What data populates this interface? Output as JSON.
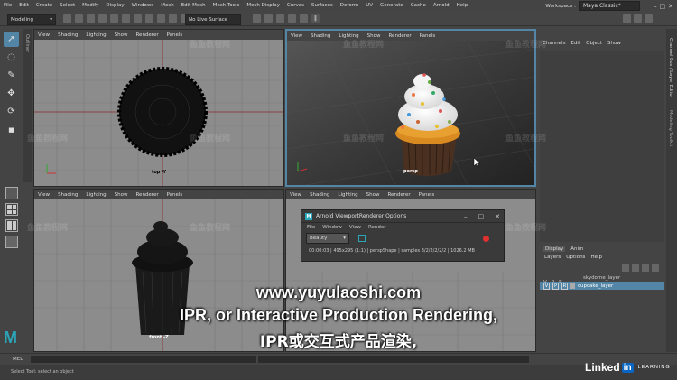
{
  "menubar": {
    "items": [
      "File",
      "Edit",
      "Create",
      "Select",
      "Modify",
      "Display",
      "Windows",
      "Mesh",
      "Edit Mesh",
      "Mesh Tools",
      "Mesh Display",
      "Curves",
      "Surfaces",
      "Deform",
      "UV",
      "Generate",
      "Cache",
      "Arnold",
      "Help"
    ],
    "workspace_label": "Workspace :",
    "workspace_value": "Maya Classic*"
  },
  "statusline": {
    "mode": "Modeling",
    "live_surface": "No Live Surface"
  },
  "viewports": {
    "menu": [
      "View",
      "Shading",
      "Lighting",
      "Show",
      "Renderer",
      "Panels"
    ],
    "top_label": "top -Y",
    "persp_label": "persp",
    "front_label": "front -Z"
  },
  "side_tabs": {
    "outliner": "Outliner",
    "channel_box": "Channel Box / Layer Editor",
    "modeling_toolkit": "Modeling Toolkit"
  },
  "channel_box": {
    "tabs": [
      "Channels",
      "Edit",
      "Object",
      "Show"
    ]
  },
  "layer_editor": {
    "tabs": [
      "Display",
      "Anim"
    ],
    "menu": [
      "Layers",
      "Options",
      "Help"
    ],
    "columns": [
      "V",
      "P",
      "R"
    ],
    "layers": [
      {
        "name": "skydome_layer",
        "v": "",
        "p": "",
        "r": "",
        "selected": false
      },
      {
        "name": "cupcake_layer",
        "v": "V",
        "p": "P",
        "r": "R",
        "selected": true
      }
    ]
  },
  "arnold_window": {
    "title": "Arnold ViewportRenderer Options",
    "menu": [
      "File",
      "Window",
      "View",
      "Render"
    ],
    "aov": "Beauty",
    "status": "00:00:03 | 495x295 (1:1) | perspShape | samples 3/2/2/2/2/2 | 1026.2 MB"
  },
  "cmdline": {
    "label": "MEL"
  },
  "helpline": {
    "text": "Select Tool: select an object"
  },
  "subtitles": {
    "url": "www.yuyulaoshi.com",
    "line_en": "IPR, or Interactive Production Rendering,",
    "line_zh": "IPR或交互式产品渲染,"
  },
  "watermark": {
    "text": "鱼鱼教程网"
  },
  "branding": {
    "linkedin": "Linked",
    "linkedin_in": "in",
    "learning": "LEARNING",
    "maya_logo": "M"
  },
  "colors": {
    "accent": "#5285a6",
    "record": "#e03030",
    "ui_bg": "#444444"
  }
}
